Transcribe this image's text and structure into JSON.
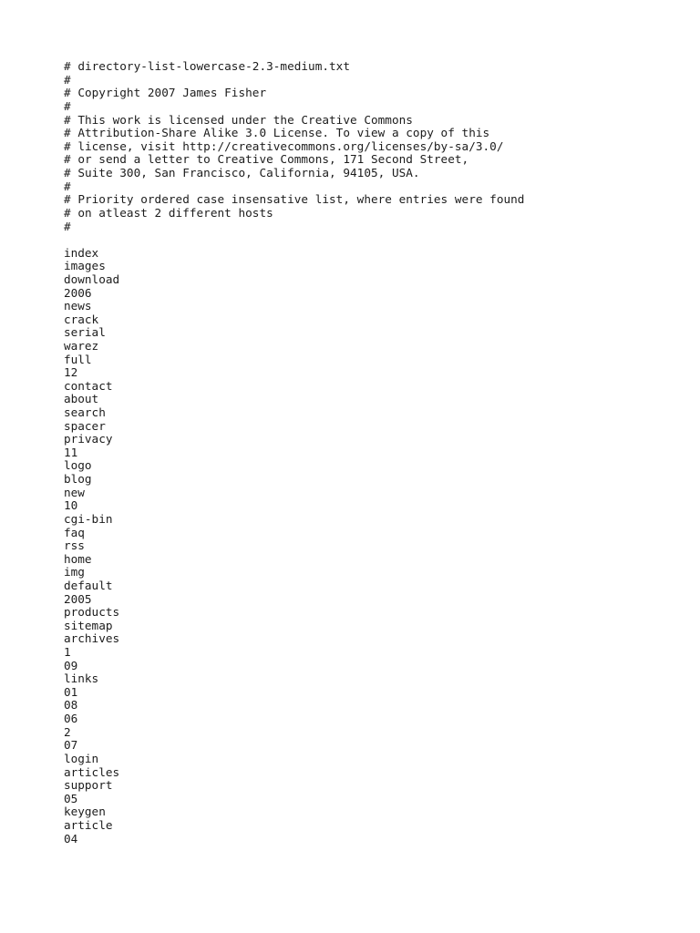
{
  "document": {
    "filename": "directory-list-lowercase-2.3-medium.txt",
    "background_color": "#ffffff",
    "text_color": "#1c1c1c",
    "header_lines": [
      "# directory-list-lowercase-2.3-medium.txt",
      "#",
      "# Copyright 2007 James Fisher",
      "#",
      "# This work is licensed under the Creative Commons",
      "# Attribution-Share Alike 3.0 License. To view a copy of this",
      "# license, visit http://creativecommons.org/licenses/by-sa/3.0/",
      "# or send a letter to Creative Commons, 171 Second Street,",
      "# Suite 300, San Francisco, California, 94105, USA.",
      "#",
      "# Priority ordered case insensative list, where entries were found",
      "# on atleast 2 different hosts",
      "#"
    ],
    "entries": [
      "index",
      "images",
      "download",
      "2006",
      "news",
      "crack",
      "serial",
      "warez",
      "full",
      "12",
      "contact",
      "about",
      "search",
      "spacer",
      "privacy",
      "11",
      "logo",
      "blog",
      "new",
      "10",
      "cgi-bin",
      "faq",
      "rss",
      "home",
      "img",
      "default",
      "2005",
      "products",
      "sitemap",
      "archives",
      "1",
      "09",
      "links",
      "01",
      "08",
      "06",
      "2",
      "07",
      "login",
      "articles",
      "support",
      "05",
      "keygen",
      "article",
      "04"
    ]
  }
}
